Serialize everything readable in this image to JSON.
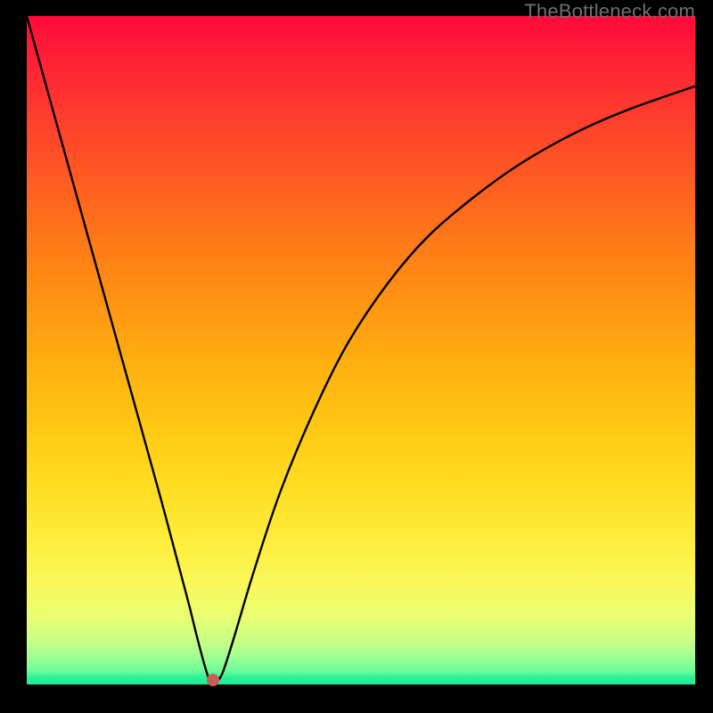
{
  "watermark": "TheBottleneck.com",
  "seed": {
    "x_pct": 27.9,
    "y_pct": 99.3
  },
  "chart_data": {
    "type": "line",
    "title": "",
    "xlabel": "",
    "ylabel": "",
    "xlim": [
      0,
      100
    ],
    "ylim": [
      0,
      100
    ],
    "grid": false,
    "legend": false,
    "series": [
      {
        "name": "bottleneck-curve",
        "x": [
          0,
          5,
          10,
          15,
          20,
          24,
          25.5,
          26.8,
          27.4,
          28.0,
          28.6,
          29.4,
          31,
          34,
          38,
          43,
          48,
          54,
          60,
          67,
          74,
          82,
          90,
          100
        ],
        "y": [
          100,
          82,
          64,
          46,
          28,
          13,
          7,
          2.2,
          0.6,
          0.4,
          0.6,
          2.0,
          7,
          17,
          29,
          41,
          51,
          60,
          67,
          73,
          78,
          82.5,
          86,
          89.5
        ]
      }
    ],
    "annotations": [
      {
        "type": "point",
        "name": "marker",
        "x": 27.9,
        "y": 0.7
      }
    ],
    "background_gradient": {
      "direction": "vertical",
      "stops": [
        {
          "pos": 0.0,
          "color": "#ff0a3a"
        },
        {
          "pos": 0.5,
          "color": "#ffae10"
        },
        {
          "pos": 0.82,
          "color": "#fef548"
        },
        {
          "pos": 1.0,
          "color": "#18eb9f"
        }
      ]
    }
  }
}
